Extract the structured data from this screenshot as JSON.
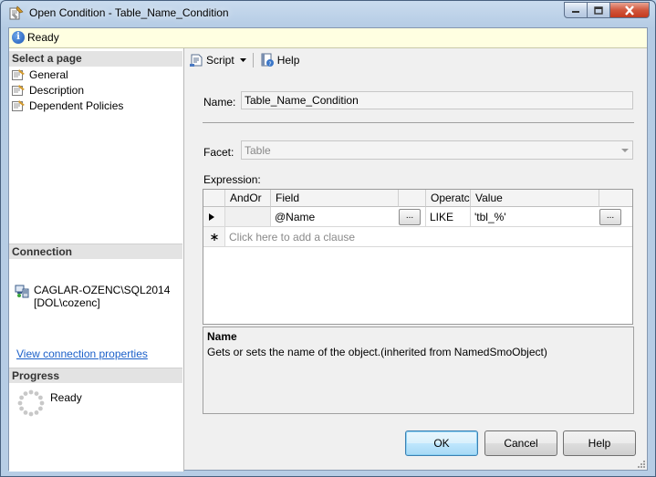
{
  "window": {
    "title": "Open Condition - Table_Name_Condition"
  },
  "status": {
    "icon": "info-icon",
    "text": "Ready"
  },
  "left_pane": {
    "select_page_header": "Select a page",
    "pages": [
      {
        "label": "General",
        "icon": "wrench-page-icon"
      },
      {
        "label": "Description",
        "icon": "wrench-page-icon"
      },
      {
        "label": "Dependent Policies",
        "icon": "wrench-page-icon"
      }
    ],
    "connection_header": "Connection",
    "connection_server": "CAGLAR-OZENC\\SQL2014",
    "connection_user": "[DOL\\cozenc]",
    "connection_link": "View connection properties",
    "progress_header": "Progress",
    "progress_status": "Ready"
  },
  "toolbar": {
    "script_label": "Script",
    "help_label": "Help"
  },
  "form": {
    "name_label": "Name:",
    "name_value": "Table_Name_Condition",
    "facet_label": "Facet:",
    "facet_value": "Table",
    "expression_label": "Expression:"
  },
  "grid": {
    "headers": {
      "andor": "AndOr",
      "field": "Field",
      "operator": "Operatc",
      "value": "Value"
    },
    "row1": {
      "andor": "",
      "field": "@Name",
      "operator": "LIKE",
      "value": "'tbl_%'",
      "field_btn": "...",
      "value_btn": "..."
    },
    "new_row_text": "Click here to add a clause"
  },
  "description": {
    "title": "Name",
    "text": "Gets or sets the name of the object.(inherited from NamedSmoObject)"
  },
  "buttons": {
    "ok": "OK",
    "cancel": "Cancel",
    "help": "Help"
  }
}
